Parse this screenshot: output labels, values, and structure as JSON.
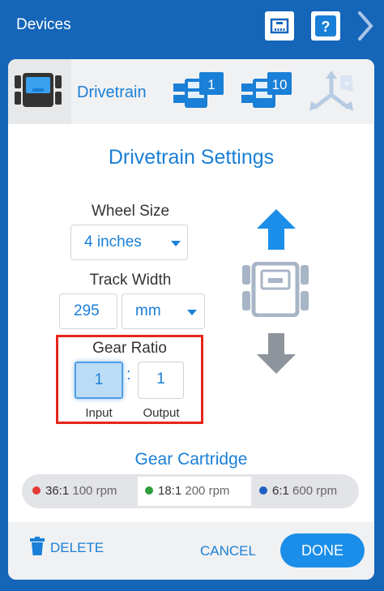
{
  "topbar": {
    "title": "Devices"
  },
  "tabs": {
    "active_label": "Drivetrain",
    "motor_group_1_badge": "1",
    "motor_group_10_badge": "10"
  },
  "settings": {
    "title": "Drivetrain Settings",
    "wheel_size_label": "Wheel Size",
    "wheel_size_value": "4 inches",
    "track_width_label": "Track Width",
    "track_width_value": "295",
    "track_width_unit": "mm",
    "gear_ratio_label": "Gear Ratio",
    "gear_input_value": "1",
    "gear_output_value": "1",
    "colon": ":",
    "input_label": "Input",
    "output_label": "Output"
  },
  "gear_cartridge": {
    "title": "Gear Cartridge",
    "options": [
      {
        "ratio": "36:1",
        "rpm": "100 rpm",
        "color": "#e53935"
      },
      {
        "ratio": "18:1",
        "rpm": "200 rpm",
        "color": "#2e9e3a"
      },
      {
        "ratio": "6:1",
        "rpm": "600 rpm",
        "color": "#1e5fbf"
      }
    ],
    "selected": "18:1"
  },
  "footer": {
    "delete_label": "DELETE",
    "cancel_label": "CANCEL",
    "done_label": "DONE"
  },
  "colors": {
    "accent": "#1a7fd6",
    "topbar": "#1565b9",
    "highlight": "#e5261b"
  }
}
